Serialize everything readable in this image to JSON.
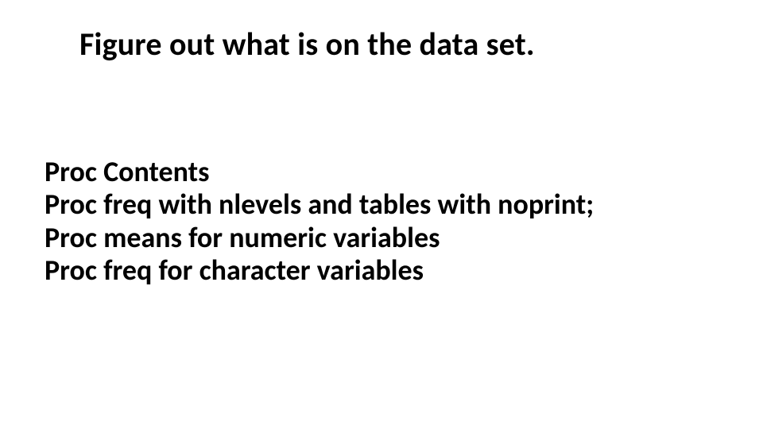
{
  "slide": {
    "title": "Figure out what is on the data set.",
    "body": {
      "line1": "Proc Contents",
      "line2": "Proc freq with nlevels and tables with noprint;",
      "line3": "Proc means for numeric variables",
      "line4": "Proc freq for character variables"
    }
  }
}
